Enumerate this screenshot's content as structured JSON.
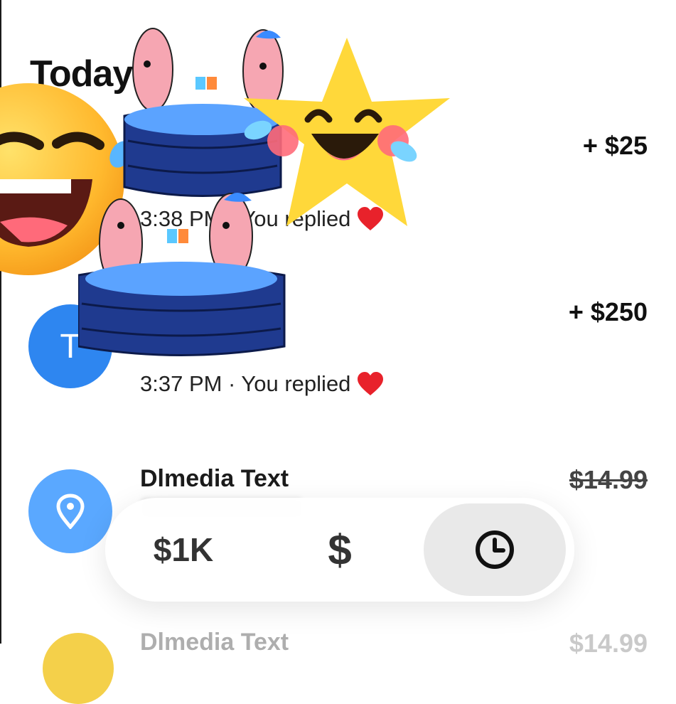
{
  "section": {
    "title": "Today"
  },
  "transactions": [
    {
      "amount": "+ $25",
      "meta": "3:38 PM · You replied"
    },
    {
      "avatar_letter": "T",
      "amount": "+ $250",
      "meta": "3:37 PM · You replied"
    },
    {
      "title": "Dlmedia Text",
      "amount": "$14.99"
    },
    {
      "title": "Dlmedia Text",
      "amount": "$14.99"
    }
  ],
  "tabbar": {
    "balance_label": "$1K",
    "pay_label": "$",
    "active_tab": "activity"
  },
  "icons": [
    "heart-icon",
    "location-pin-icon",
    "clock-icon"
  ],
  "colors": {
    "accent_blue": "#2e86f0",
    "light_blue": "#5aa8ff",
    "heart": "#e8222b"
  }
}
